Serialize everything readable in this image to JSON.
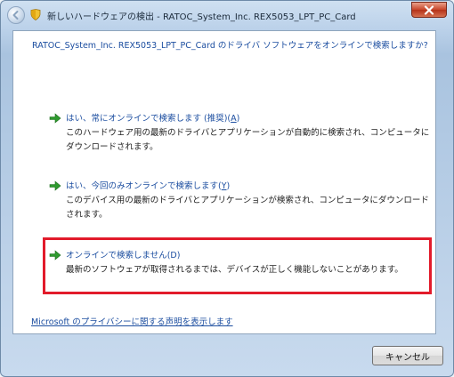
{
  "window": {
    "title": "新しいハードウェアの検出 - RATOC_System_Inc. REX5053_LPT_PC_Card"
  },
  "intro_text": "RATOC_System_Inc. REX5053_LPT_PC_Card のドライバ ソフトウェアをオンラインで検索しますか?",
  "options": [
    {
      "title_prefix": "はい、常にオンラインで検索します (推奨)(",
      "key": "A",
      "title_suffix": ")",
      "description": "このハードウェア用の最新のドライバとアプリケーションが自動的に検索され、コンピュータにダウンロードされます。"
    },
    {
      "title_prefix": "はい、今回のみオンラインで検索します(",
      "key": "Y",
      "title_suffix": ")",
      "description": "このデバイス用の最新のドライバとアプリケーションが検索され、コンピュータにダウンロードされます。"
    },
    {
      "title_prefix": "オンラインで検索しません(D)",
      "key": "",
      "title_suffix": "",
      "description": "最新のソフトウェアが取得されるまでは、デバイスが正しく機能しないことがあります。"
    }
  ],
  "privacy_link": "Microsoft のプライバシーに関する声明を表示します",
  "cancel_label": "キャンセル",
  "colors": {
    "link_blue": "#1c4ea0",
    "arrow_green": "#2e9a2e",
    "highlight_red": "#e21b2b"
  },
  "icons": {
    "back": "back-arrow-icon",
    "shield": "security-shield-icon",
    "close": "close-icon",
    "option_arrow": "green-arrow-icon"
  }
}
